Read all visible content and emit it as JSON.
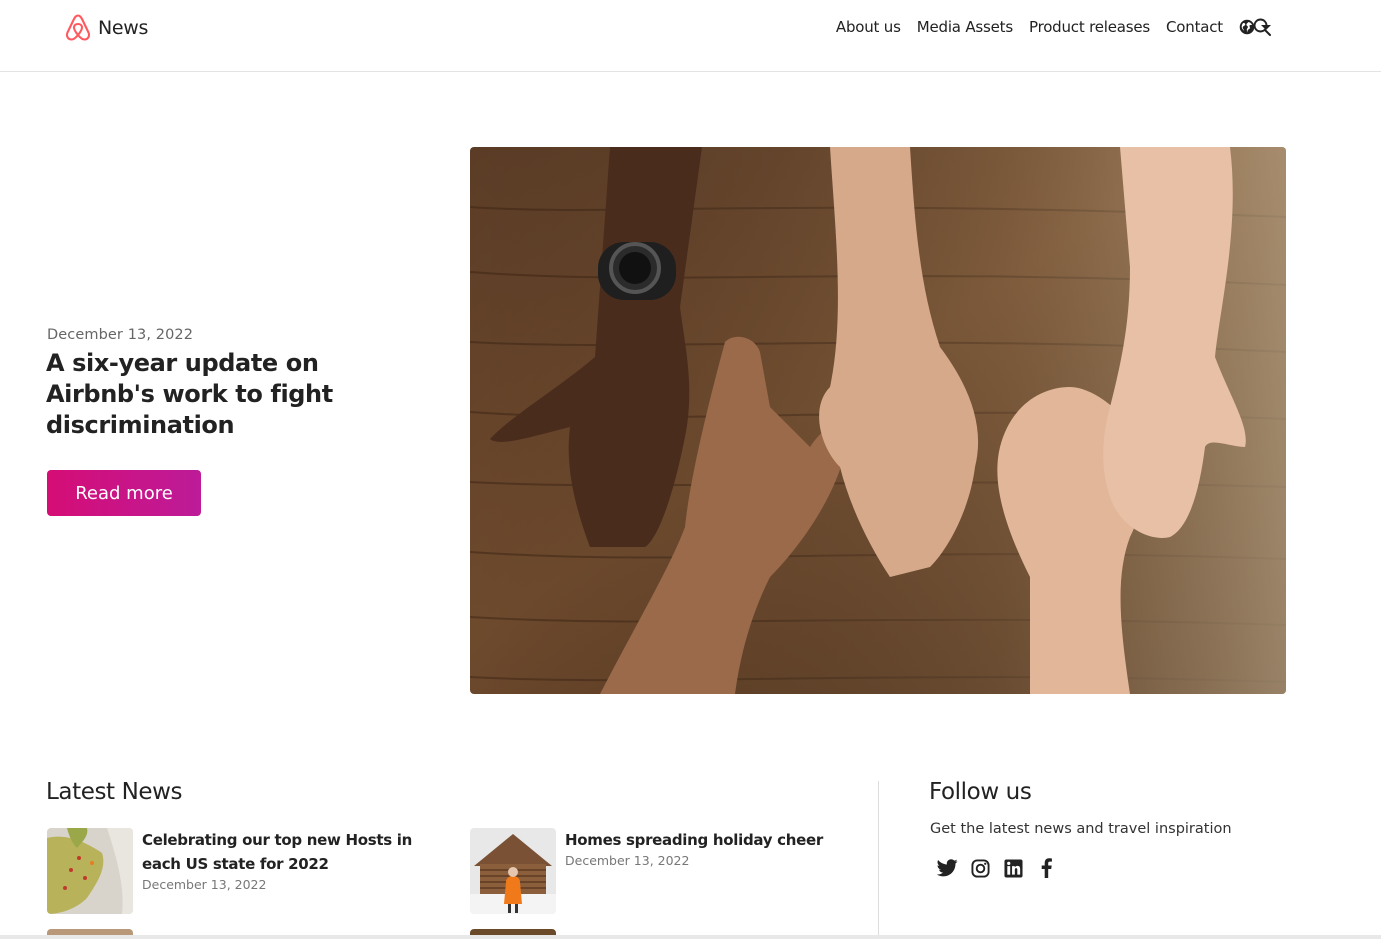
{
  "header": {
    "brand_label": "News",
    "nav": {
      "about": "About us",
      "media": "Media Assets",
      "products": "Product releases",
      "contact": "Contact"
    },
    "brand_color": "#FF5A5F"
  },
  "hero": {
    "date": "December 13, 2022",
    "title": "A six-year update on Airbnb's work to fight discrimination",
    "button_label": "Read more",
    "button_color": "#D50D75"
  },
  "latest": {
    "heading": "Latest News",
    "items": [
      {
        "title": "Celebrating our top new Hosts in each US state for 2022",
        "date": "December 13, 2022"
      },
      {
        "title": "Homes spreading holiday cheer",
        "date": "December 13, 2022"
      }
    ]
  },
  "follow": {
    "heading": "Follow us",
    "subtitle": "Get the latest news and travel inspiration",
    "networks": [
      "twitter-icon",
      "instagram-icon",
      "linkedin-icon",
      "facebook-icon"
    ]
  }
}
